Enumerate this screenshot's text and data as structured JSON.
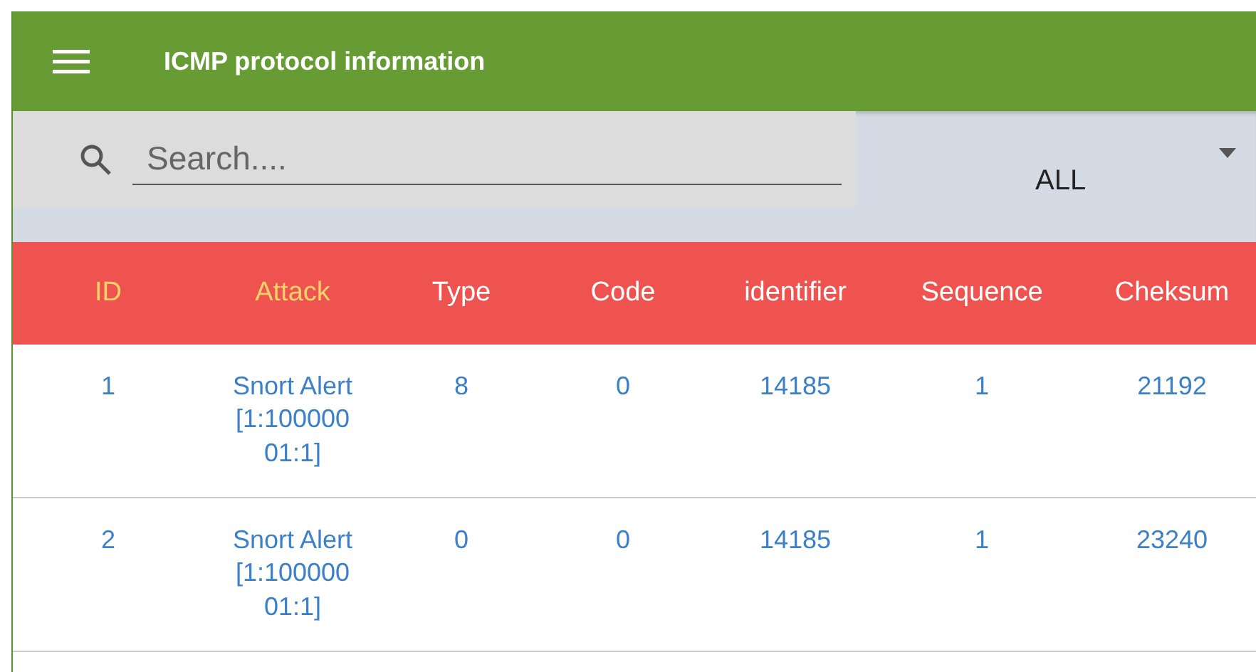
{
  "app_bar": {
    "title": "ICMP protocol information"
  },
  "search": {
    "placeholder": "Search...."
  },
  "filter": {
    "value": "ALL"
  },
  "table": {
    "columns": [
      {
        "label": "ID",
        "color": "#f7d26b"
      },
      {
        "label": "Attack",
        "color": "#f7d26b"
      },
      {
        "label": "Type",
        "color": "#ffffff"
      },
      {
        "label": "Code",
        "color": "#ffffff"
      },
      {
        "label": "identifier",
        "color": "#ffffff"
      },
      {
        "label": "Sequence",
        "color": "#ffffff"
      },
      {
        "label": "Cheksum",
        "color": "#ffffff"
      }
    ],
    "rows": [
      [
        "1",
        "Snort Alert [1:10000001:1]",
        "8",
        "0",
        "14185",
        "1",
        "21192"
      ],
      [
        "2",
        "Snort Alert [1:10000001:1]",
        "0",
        "0",
        "14185",
        "1",
        "23240"
      ]
    ]
  }
}
